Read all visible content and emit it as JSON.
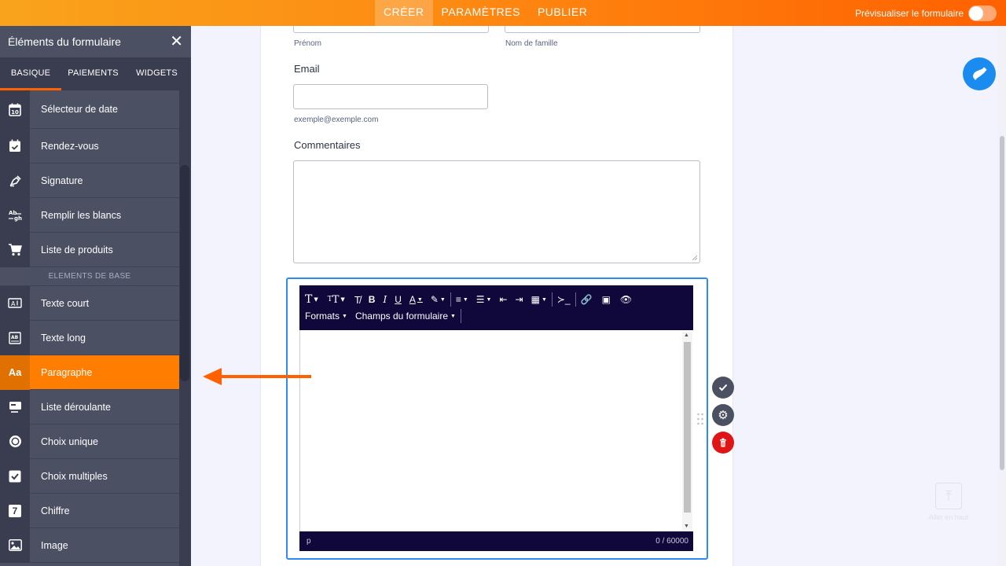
{
  "topbar": {
    "tabs": [
      {
        "label": "CRÉER",
        "active": true
      },
      {
        "label": "PARAMÈTRES",
        "active": false
      },
      {
        "label": "PUBLIER",
        "active": false
      }
    ],
    "preview_label": "Prévisualiser le formulaire",
    "preview_on": false
  },
  "sidebar": {
    "title": "Éléments du formulaire",
    "tabs": [
      {
        "label": "BASIQUE",
        "active": true
      },
      {
        "label": "PAIEMENTS",
        "active": false
      },
      {
        "label": "WIDGETS",
        "active": false
      }
    ],
    "items_top": [
      {
        "label": "Sélecteur de date",
        "icon": "calendar-10-icon"
      },
      {
        "label": "Rendez-vous",
        "icon": "calendar-check-icon"
      },
      {
        "label": "Signature",
        "icon": "pen-icon"
      },
      {
        "label": "Remplir les blancs",
        "icon": "fill-blank-icon"
      },
      {
        "label": "Liste de produits",
        "icon": "cart-icon"
      }
    ],
    "section_label": "ELEMENTS DE BASE",
    "items_bottom": [
      {
        "label": "Texte court",
        "icon": "short-text-icon"
      },
      {
        "label": "Texte long",
        "icon": "long-text-icon"
      },
      {
        "label": "Paragraphe",
        "icon": "paragraph-icon",
        "active": true
      },
      {
        "label": "Liste déroulante",
        "icon": "dropdown-icon"
      },
      {
        "label": "Choix unique",
        "icon": "radio-icon"
      },
      {
        "label": "Choix multiples",
        "icon": "checkbox-icon"
      },
      {
        "label": "Chiffre",
        "icon": "number-icon"
      },
      {
        "label": "Image",
        "icon": "image-icon"
      }
    ],
    "icon_glyphs": {
      "paragraph": "Aa",
      "number": "7",
      "fillblank": "Ab\n—gh"
    }
  },
  "form": {
    "first_name_sublabel": "Prénom",
    "last_name_sublabel": "Nom de famille",
    "email_label": "Email",
    "email_sublabel": "exemple@exemple.com",
    "comments_label": "Commentaires"
  },
  "editor": {
    "formats_label": "Formats",
    "fields_label": "Champs du formulaire",
    "status_path": "p",
    "char_count": "0 / 60000"
  },
  "back_to_top": "Aller en haut",
  "colors": {
    "accent": "#ff6100",
    "selection": "#2e8bf1",
    "toolbar": "#10073a"
  }
}
